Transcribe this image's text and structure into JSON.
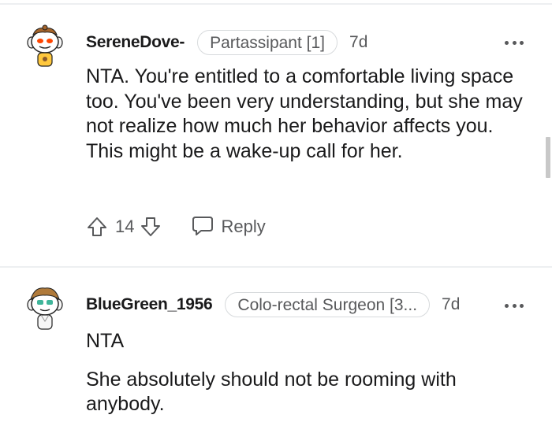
{
  "comments": [
    {
      "username": "SereneDove-",
      "flair": "Partassipant [1]",
      "time": "7d",
      "avatar_icon": "snoo-avatar-orange-eyes",
      "paragraphs": [
        "NTA. You're entitled to a comfortable living space too. You've been very understanding, but she may not realize how much her behavior affects you. This might be a wake-up call for her."
      ],
      "score": "14",
      "reply_label": "Reply"
    },
    {
      "username": "BlueGreen_1956",
      "flair": "Colo-rectal Surgeon [3...",
      "time": "7d",
      "avatar_icon": "snoo-avatar-green-hair",
      "paragraphs": [
        "NTA",
        "She absolutely should not be rooming with anybody."
      ]
    }
  ],
  "icons": {
    "upvote": "arrow-up-icon",
    "downvote": "arrow-down-icon",
    "reply": "speech-bubble-icon",
    "more": "ellipsis-icon"
  },
  "colors": {
    "text": "#1a1a1b",
    "muted": "#58595b",
    "divider": "#edeff1",
    "flair_border": "#d7dadc"
  }
}
